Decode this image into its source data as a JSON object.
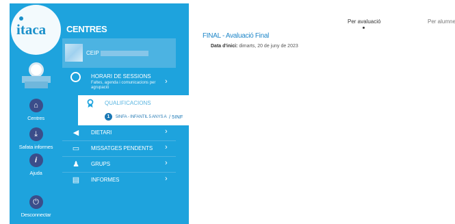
{
  "app": {
    "logo_text": "itaca"
  },
  "rail": {
    "items": [
      {
        "label": "Centres",
        "icon": "home-icon",
        "glyph": "⌂"
      },
      {
        "label": "Safata informes",
        "icon": "download-tray-icon",
        "glyph": "⤓"
      },
      {
        "label": "Ajuda",
        "icon": "info-icon",
        "glyph": "i"
      },
      {
        "label": "Desconnectar",
        "icon": "power-icon",
        "glyph": "⏻"
      }
    ]
  },
  "panel": {
    "title": "CENTRES",
    "school_prefix": "CEIP",
    "horari": {
      "label": "HORARI DE SESSIONS",
      "sub": "Faltes, agenda i comunicacions per agrupació"
    },
    "qualificacions": {
      "label": "QUALIFICACIONS",
      "badge": "1",
      "group": "5INFA - INFANTIL 5 ANYS A",
      "group_suffix": "/ 5INF"
    },
    "menu": [
      {
        "label": "DIETARI",
        "icon": "megaphone-icon",
        "glyph": "◀"
      },
      {
        "label": "MISSATGES PENDENTS",
        "icon": "chat-icon",
        "glyph": "▭"
      },
      {
        "label": "GRUPS",
        "icon": "users-icon",
        "glyph": "♟"
      },
      {
        "label": "INFORMES",
        "icon": "document-icon",
        "glyph": "▤"
      }
    ],
    "chevron": "›"
  },
  "main": {
    "tabs": [
      {
        "label": "Per avaluació",
        "active": true
      },
      {
        "label": "Per alumne",
        "active": false
      }
    ],
    "evaluation": {
      "title": "FINAL - Avaluació Final",
      "date_label": "Data d'inici:",
      "date_value": "dimarts, 20 de juny de 2023"
    }
  },
  "colors": {
    "sidebar": "#1ea3dd",
    "link": "#1e86c8"
  }
}
